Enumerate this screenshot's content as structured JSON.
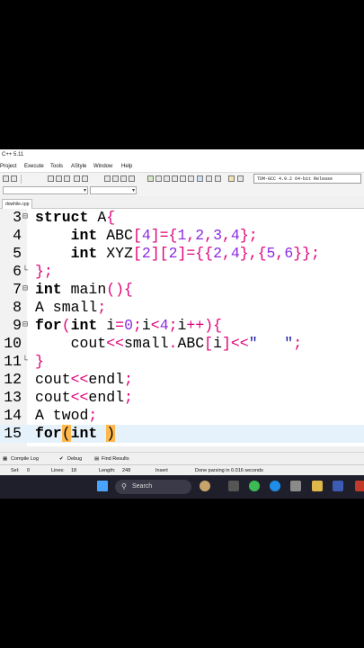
{
  "window": {
    "title": "C++ 5.11"
  },
  "menu": [
    "Project",
    "Execute",
    "Tools",
    "AStyle",
    "Window",
    "Help"
  ],
  "compiler": {
    "selected": "TDM-GCC 4.9.2 64-bit Release"
  },
  "tabs": [
    {
      "label": "dowhile.cpp"
    }
  ],
  "editor": {
    "lines": [
      {
        "n": "3",
        "fold": "⊟",
        "segments": [
          {
            "t": "struct",
            "c": "kw"
          },
          {
            "t": " A"
          },
          {
            "t": "{",
            "c": "sym"
          }
        ]
      },
      {
        "n": "4",
        "segments": [
          {
            "t": "    "
          },
          {
            "t": "int",
            "c": "kw"
          },
          {
            "t": " ABC"
          },
          {
            "t": "[",
            "c": "sym"
          },
          {
            "t": "4",
            "c": "num"
          },
          {
            "t": "]={",
            "c": "sym"
          },
          {
            "t": "1",
            "c": "num"
          },
          {
            "t": ",",
            "c": "sym"
          },
          {
            "t": "2",
            "c": "num"
          },
          {
            "t": ",",
            "c": "sym"
          },
          {
            "t": "3",
            "c": "num"
          },
          {
            "t": ",",
            "c": "sym"
          },
          {
            "t": "4",
            "c": "num"
          },
          {
            "t": "};",
            "c": "sym"
          }
        ]
      },
      {
        "n": "5",
        "segments": [
          {
            "t": "    "
          },
          {
            "t": "int",
            "c": "kw"
          },
          {
            "t": " XYZ"
          },
          {
            "t": "[",
            "c": "sym"
          },
          {
            "t": "2",
            "c": "num"
          },
          {
            "t": "][",
            "c": "sym"
          },
          {
            "t": "2",
            "c": "num"
          },
          {
            "t": "]={{",
            "c": "sym"
          },
          {
            "t": "2",
            "c": "num"
          },
          {
            "t": ",",
            "c": "sym"
          },
          {
            "t": "4",
            "c": "num"
          },
          {
            "t": "},{",
            "c": "sym"
          },
          {
            "t": "5",
            "c": "num"
          },
          {
            "t": ",",
            "c": "sym"
          },
          {
            "t": "6",
            "c": "num"
          },
          {
            "t": "}};",
            "c": "sym"
          }
        ]
      },
      {
        "n": "6",
        "fold": "└",
        "segments": [
          {
            "t": "};",
            "c": "sym"
          }
        ]
      },
      {
        "n": "7",
        "fold": "⊟",
        "segments": [
          {
            "t": "int",
            "c": "kw"
          },
          {
            "t": " main"
          },
          {
            "t": "(){",
            "c": "sym"
          }
        ]
      },
      {
        "n": "8",
        "segments": [
          {
            "t": "A small"
          },
          {
            "t": ";",
            "c": "sym"
          }
        ]
      },
      {
        "n": "9",
        "fold": "⊟",
        "segments": [
          {
            "t": "for",
            "c": "kw"
          },
          {
            "t": "(",
            "c": "sym"
          },
          {
            "t": "int",
            "c": "kw"
          },
          {
            "t": " i"
          },
          {
            "t": "=",
            "c": "sym"
          },
          {
            "t": "0",
            "c": "num"
          },
          {
            "t": ";",
            "c": "sym"
          },
          {
            "t": "i"
          },
          {
            "t": "<",
            "c": "sym"
          },
          {
            "t": "4",
            "c": "num"
          },
          {
            "t": ";",
            "c": "sym"
          },
          {
            "t": "i"
          },
          {
            "t": "++){",
            "c": "sym"
          }
        ]
      },
      {
        "n": "10",
        "segments": [
          {
            "t": "    cout"
          },
          {
            "t": "<<",
            "c": "sym"
          },
          {
            "t": "small"
          },
          {
            "t": ".",
            "c": "sym"
          },
          {
            "t": "ABC"
          },
          {
            "t": "[",
            "c": "sym"
          },
          {
            "t": "i"
          },
          {
            "t": "]<<",
            "c": "sym"
          },
          {
            "t": "\"   \"",
            "c": "str"
          },
          {
            "t": ";",
            "c": "sym"
          }
        ]
      },
      {
        "n": "11",
        "fold": "└",
        "segments": [
          {
            "t": "}",
            "c": "sym"
          }
        ]
      },
      {
        "n": "12",
        "segments": [
          {
            "t": "cout"
          },
          {
            "t": "<<",
            "c": "sym"
          },
          {
            "t": "endl"
          },
          {
            "t": ";",
            "c": "sym"
          }
        ]
      },
      {
        "n": "13",
        "segments": [
          {
            "t": "cout"
          },
          {
            "t": "<<",
            "c": "sym"
          },
          {
            "t": "endl"
          },
          {
            "t": ";",
            "c": "sym"
          }
        ]
      },
      {
        "n": "14",
        "segments": [
          {
            "t": "A twod"
          },
          {
            "t": ";",
            "c": "sym"
          }
        ]
      },
      {
        "n": "15",
        "current": true,
        "segments": [
          {
            "t": "for",
            "c": "kw"
          },
          {
            "t": "(",
            "c": "sym hl"
          },
          {
            "t": "int",
            "c": "kw"
          },
          {
            "t": " "
          },
          {
            "t": ")",
            "c": "sym hl"
          }
        ]
      }
    ]
  },
  "bottom_tabs": [
    "Compile Log",
    "Debug",
    "Find Results"
  ],
  "status": {
    "sel_label": "Sel:",
    "sel_value": "0",
    "lines_label": "Lines:",
    "lines_value": "18",
    "length_label": "Length:",
    "length_value": "248",
    "mode": "Insert",
    "message": "Done parsing in 0.016 seconds"
  },
  "taskbar": {
    "search_placeholder": "Search"
  },
  "colors": {
    "keyword": "#000000",
    "symbol": "#e0007a",
    "number": "#8a2be2",
    "string": "#1a1aa8",
    "brace_match": "#ffb84d",
    "current_line": "#e6f2fb"
  }
}
